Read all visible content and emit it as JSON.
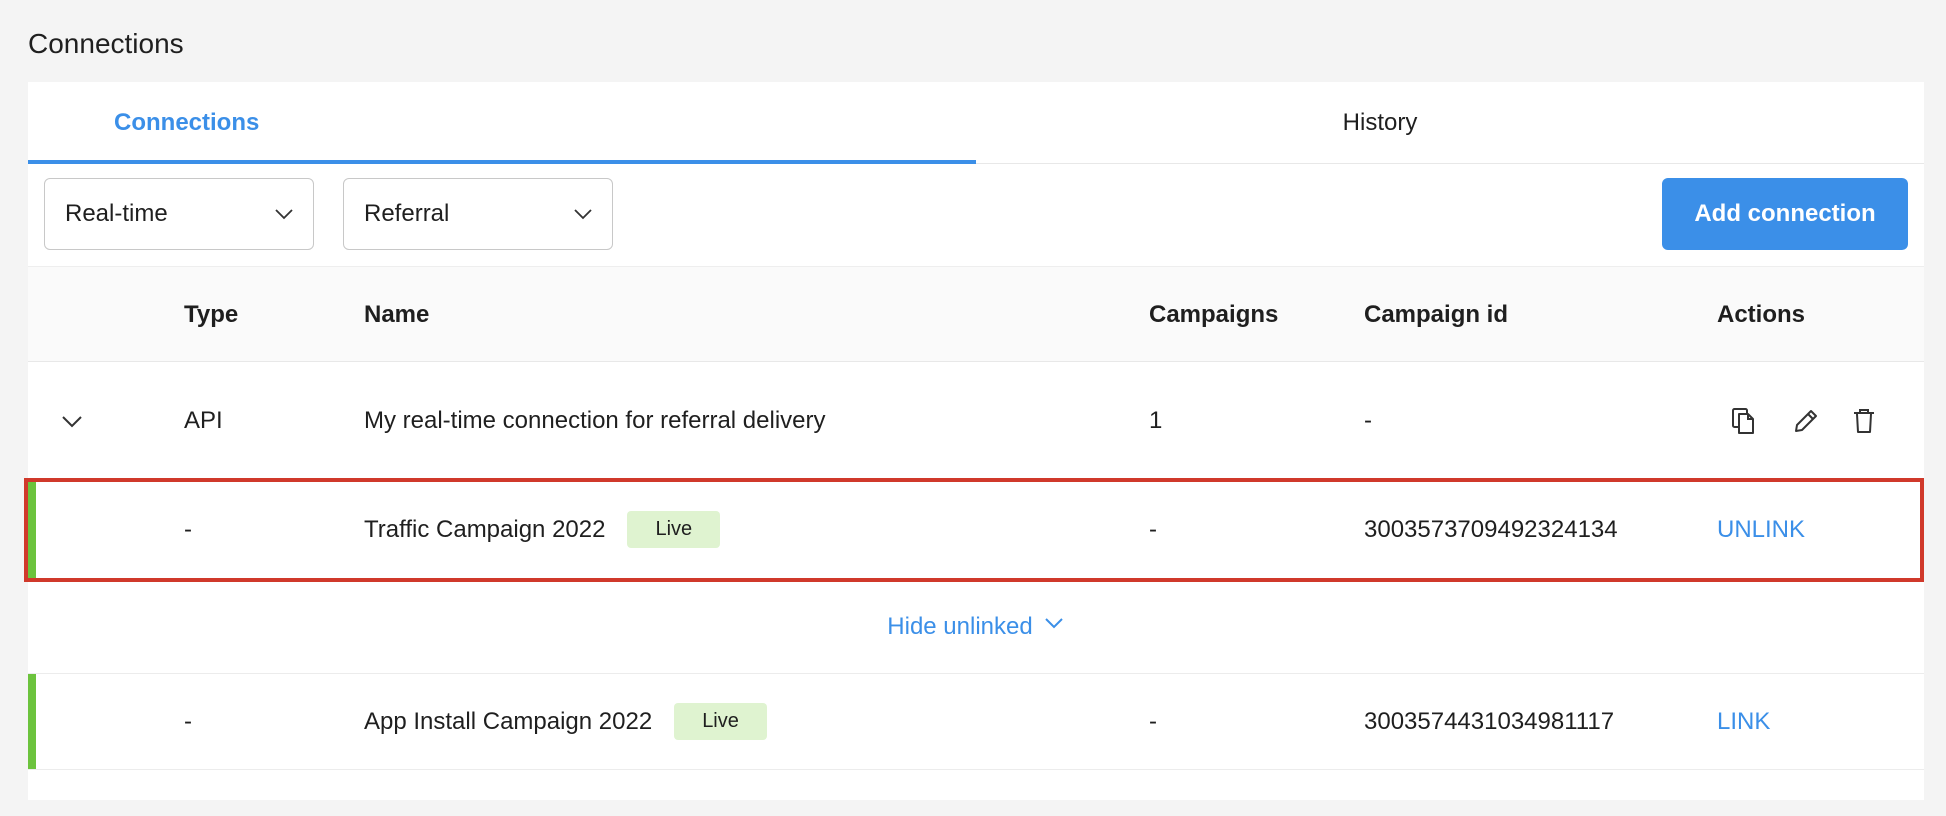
{
  "page": {
    "title": "Connections"
  },
  "tabs": [
    {
      "label": "Connections",
      "active": true
    },
    {
      "label": "History",
      "active": false
    }
  ],
  "filters": {
    "delivery_type": {
      "value": "Real-time"
    },
    "category": {
      "value": "Referral"
    }
  },
  "toolbar": {
    "add_connection_label": "Add connection"
  },
  "table": {
    "columns": [
      "Type",
      "Name",
      "Campaigns",
      "Campaign id",
      "Actions"
    ],
    "connection": {
      "type": "API",
      "name": "My real-time connection for referral delivery",
      "campaigns": "1",
      "campaign_id": "-",
      "actions": [
        "copy-icon",
        "edit-icon",
        "delete-icon"
      ]
    },
    "linked_campaign": {
      "type": "-",
      "name": "Traffic Campaign 2022",
      "status": "Live",
      "campaigns": "-",
      "campaign_id": "3003573709492324134",
      "action_label": "UNLINK"
    },
    "toggle_label": "Hide unlinked",
    "unlinked_campaign": {
      "type": "-",
      "name": "App Install Campaign 2022",
      "status": "Live",
      "campaigns": "-",
      "campaign_id": "3003574431034981117",
      "action_label": "LINK"
    }
  },
  "colors": {
    "accent": "#3b8fe8",
    "live_badge_bg": "#dff3d0",
    "row_indicator": "#6cc33d",
    "highlight_border": "#d0392b"
  }
}
